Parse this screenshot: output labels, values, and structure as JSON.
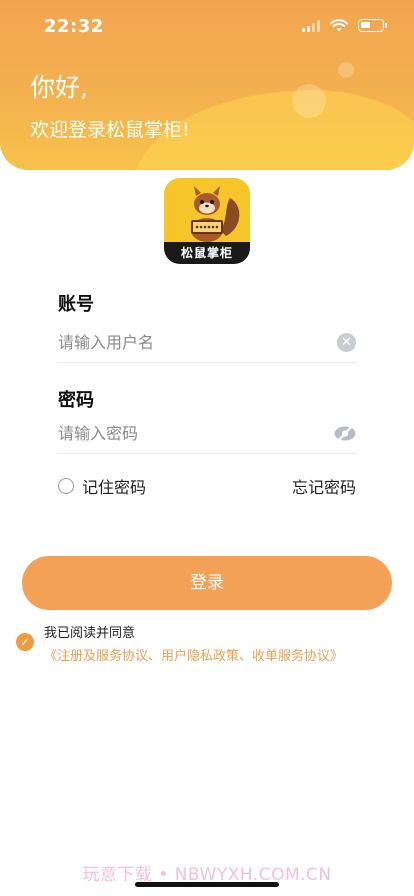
{
  "status_bar": {
    "time": "22:32"
  },
  "header": {
    "greeting": "你好,",
    "welcome": "欢迎登录松鼠掌柜!"
  },
  "logo": {
    "text": "松鼠掌柜"
  },
  "account": {
    "label": "账号",
    "placeholder": "请输入用户名",
    "value": ""
  },
  "password": {
    "label": "密码",
    "placeholder": "请输入密码",
    "value": ""
  },
  "remember": {
    "label": "记住密码",
    "checked": false
  },
  "forgot_label": "忘记密码",
  "login_label": "登录",
  "agreement": {
    "checked": true,
    "text": "我已阅读并同意",
    "links": "《注册及服务协议、用户隐私政策、收单服务协议》"
  },
  "watermark": "玩意下载 • NBWYXH.COM.CN",
  "colors": {
    "accent": "#f4a158",
    "header_top": "#f2a550",
    "header_bottom": "#f6c24a",
    "link": "#f2a050"
  },
  "icons": [
    "signal-icon",
    "wifi-icon",
    "battery-icon",
    "clear-icon",
    "eye-closed-icon",
    "check-icon"
  ]
}
